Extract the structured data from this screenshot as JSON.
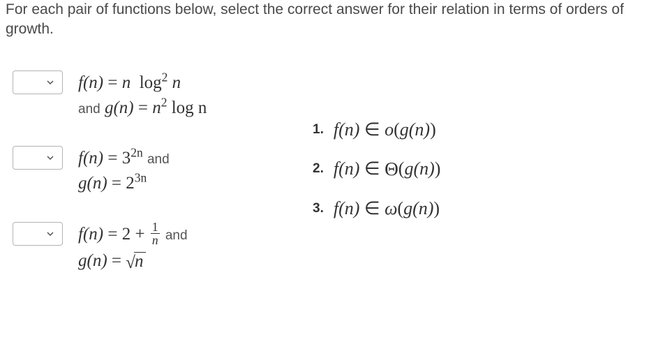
{
  "instructions": "For each pair of functions below, select the correct answer for their relation in terms of orders of growth.",
  "and_word": "and",
  "questions": [
    {
      "f_lhs": "f(n)",
      "f_rhs_a": "n",
      "f_rhs_b": "log",
      "f_sup": "2",
      "f_rhs_c": "n",
      "g_lhs": "g(n)",
      "g_rhs_a": "n",
      "g_sup": "2",
      "g_rhs_b": "log n"
    },
    {
      "f_lhs": "f(n)",
      "base_f": "3",
      "exp_f": "2n",
      "g_lhs": "g(n)",
      "base_g": "2",
      "exp_g": "3n"
    },
    {
      "f_lhs": "f(n)",
      "const": "2",
      "frac_num": "1",
      "frac_den": "n",
      "g_lhs": "g(n)",
      "sqrt_arg": "n"
    }
  ],
  "answers": [
    {
      "num": "1.",
      "lhs": "f(n)",
      "rel": "∈",
      "cls": "o",
      "arg": "g(n)"
    },
    {
      "num": "2.",
      "lhs": "f(n)",
      "rel": "∈",
      "cls": "Θ",
      "arg": "g(n)"
    },
    {
      "num": "3.",
      "lhs": "f(n)",
      "rel": "∈",
      "cls": "ω",
      "arg": "g(n)"
    }
  ]
}
